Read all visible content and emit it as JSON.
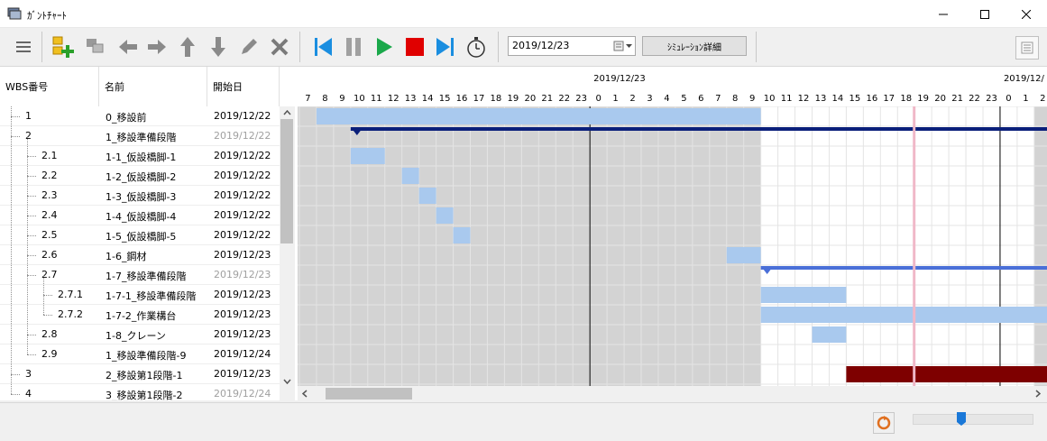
{
  "window": {
    "title": "ｶﾞﾝﾄﾁｬｰﾄ"
  },
  "toolbar": {
    "date_value": "2019/12/23",
    "sim_detail_label": "ｼﾐｭﾚｰｼｮﾝ詳細",
    "icons": [
      "menu-icon",
      "add-task-icon",
      "copy-task-icon",
      "arrow-left-icon",
      "arrow-right-icon",
      "arrow-up-icon",
      "arrow-down-icon",
      "pencil-icon",
      "delete-icon",
      "skip-start-icon",
      "pause-icon",
      "play-icon",
      "stop-icon",
      "skip-end-icon",
      "stopwatch-icon"
    ]
  },
  "grid": {
    "columns": [
      "WBS番号",
      "名前",
      "開始日"
    ],
    "rows": [
      {
        "wbs": "1",
        "name": "0_移設前",
        "start": "2019/12/22",
        "muted": false,
        "level": 0
      },
      {
        "wbs": "2",
        "name": "1_移設準備段階",
        "start": "2019/12/22",
        "muted": true,
        "level": 0
      },
      {
        "wbs": "2.1",
        "name": "1-1_仮設橋脚-1",
        "start": "2019/12/22",
        "muted": false,
        "level": 1
      },
      {
        "wbs": "2.2",
        "name": "1-2_仮設橋脚-2",
        "start": "2019/12/22",
        "muted": false,
        "level": 1
      },
      {
        "wbs": "2.3",
        "name": "1-3_仮設橋脚-3",
        "start": "2019/12/22",
        "muted": false,
        "level": 1
      },
      {
        "wbs": "2.4",
        "name": "1-4_仮設橋脚-4",
        "start": "2019/12/22",
        "muted": false,
        "level": 1
      },
      {
        "wbs": "2.5",
        "name": "1-5_仮設橋脚-5",
        "start": "2019/12/22",
        "muted": false,
        "level": 1
      },
      {
        "wbs": "2.6",
        "name": "1-6_鋼材",
        "start": "2019/12/23",
        "muted": false,
        "level": 1
      },
      {
        "wbs": "2.7",
        "name": "1-7_移設準備段階",
        "start": "2019/12/23",
        "muted": true,
        "level": 1
      },
      {
        "wbs": "2.7.1",
        "name": "1-7-1_移設準備段階",
        "start": "2019/12/23",
        "muted": false,
        "level": 2
      },
      {
        "wbs": "2.7.2",
        "name": "1-7-2_作業構台",
        "start": "2019/12/23",
        "muted": false,
        "level": 2
      },
      {
        "wbs": "2.8",
        "name": "1-8_クレーン",
        "start": "2019/12/23",
        "muted": false,
        "level": 1
      },
      {
        "wbs": "2.9",
        "name": "1_移設準備段階-9",
        "start": "2019/12/24",
        "muted": false,
        "level": 1
      },
      {
        "wbs": "3",
        "name": "2_移設第1段階-1",
        "start": "2019/12/23",
        "muted": false,
        "level": 0
      },
      {
        "wbs": "4",
        "name": "3_移設第1段階-2",
        "start": "2019/12/24",
        "muted": true,
        "level": 0
      }
    ]
  },
  "chart": {
    "date_labels": [
      "2019/12/23",
      "2019/12/"
    ],
    "hour_labels": [
      "7",
      "8",
      "9",
      "10",
      "11",
      "12",
      "13",
      "14",
      "15",
      "16",
      "17",
      "18",
      "19",
      "20",
      "21",
      "22",
      "23",
      "0",
      "1",
      "2",
      "3",
      "4",
      "5",
      "6",
      "7",
      "8",
      "9",
      "10",
      "11",
      "12",
      "13",
      "14",
      "15",
      "16",
      "17",
      "18",
      "19",
      "20",
      "21",
      "22",
      "23",
      "0",
      "1",
      "2"
    ],
    "first_hour": 7,
    "bars": [
      {
        "row": 0,
        "start": 8,
        "end": 34,
        "kind": "task"
      },
      {
        "row": 1,
        "start": 10,
        "end": 60,
        "kind": "summary"
      },
      {
        "row": 2,
        "start": 10,
        "end": 12,
        "kind": "task"
      },
      {
        "row": 3,
        "start": 13,
        "end": 14,
        "kind": "task"
      },
      {
        "row": 4,
        "start": 14,
        "end": 15,
        "kind": "task"
      },
      {
        "row": 5,
        "start": 15,
        "end": 16,
        "kind": "task"
      },
      {
        "row": 6,
        "start": 16,
        "end": 17,
        "kind": "task"
      },
      {
        "row": 7,
        "start": 32,
        "end": 34,
        "kind": "task"
      },
      {
        "row": 8,
        "start": 34,
        "end": 60,
        "kind": "summary2"
      },
      {
        "row": 9,
        "start": 34,
        "end": 39,
        "kind": "task"
      },
      {
        "row": 10,
        "start": 34,
        "end": 60,
        "kind": "task"
      },
      {
        "row": 11,
        "start": 37,
        "end": 39,
        "kind": "task"
      },
      {
        "row": 13,
        "start": 39,
        "end": 60,
        "kind": "critical"
      }
    ],
    "colors": {
      "task": "#a9c9ee",
      "summary": "#0a1f7a",
      "summary2": "#4a6fd8",
      "critical": "#7e0000",
      "nonwork": "#d3d3d3",
      "now_line": "#f0b8c8"
    }
  }
}
